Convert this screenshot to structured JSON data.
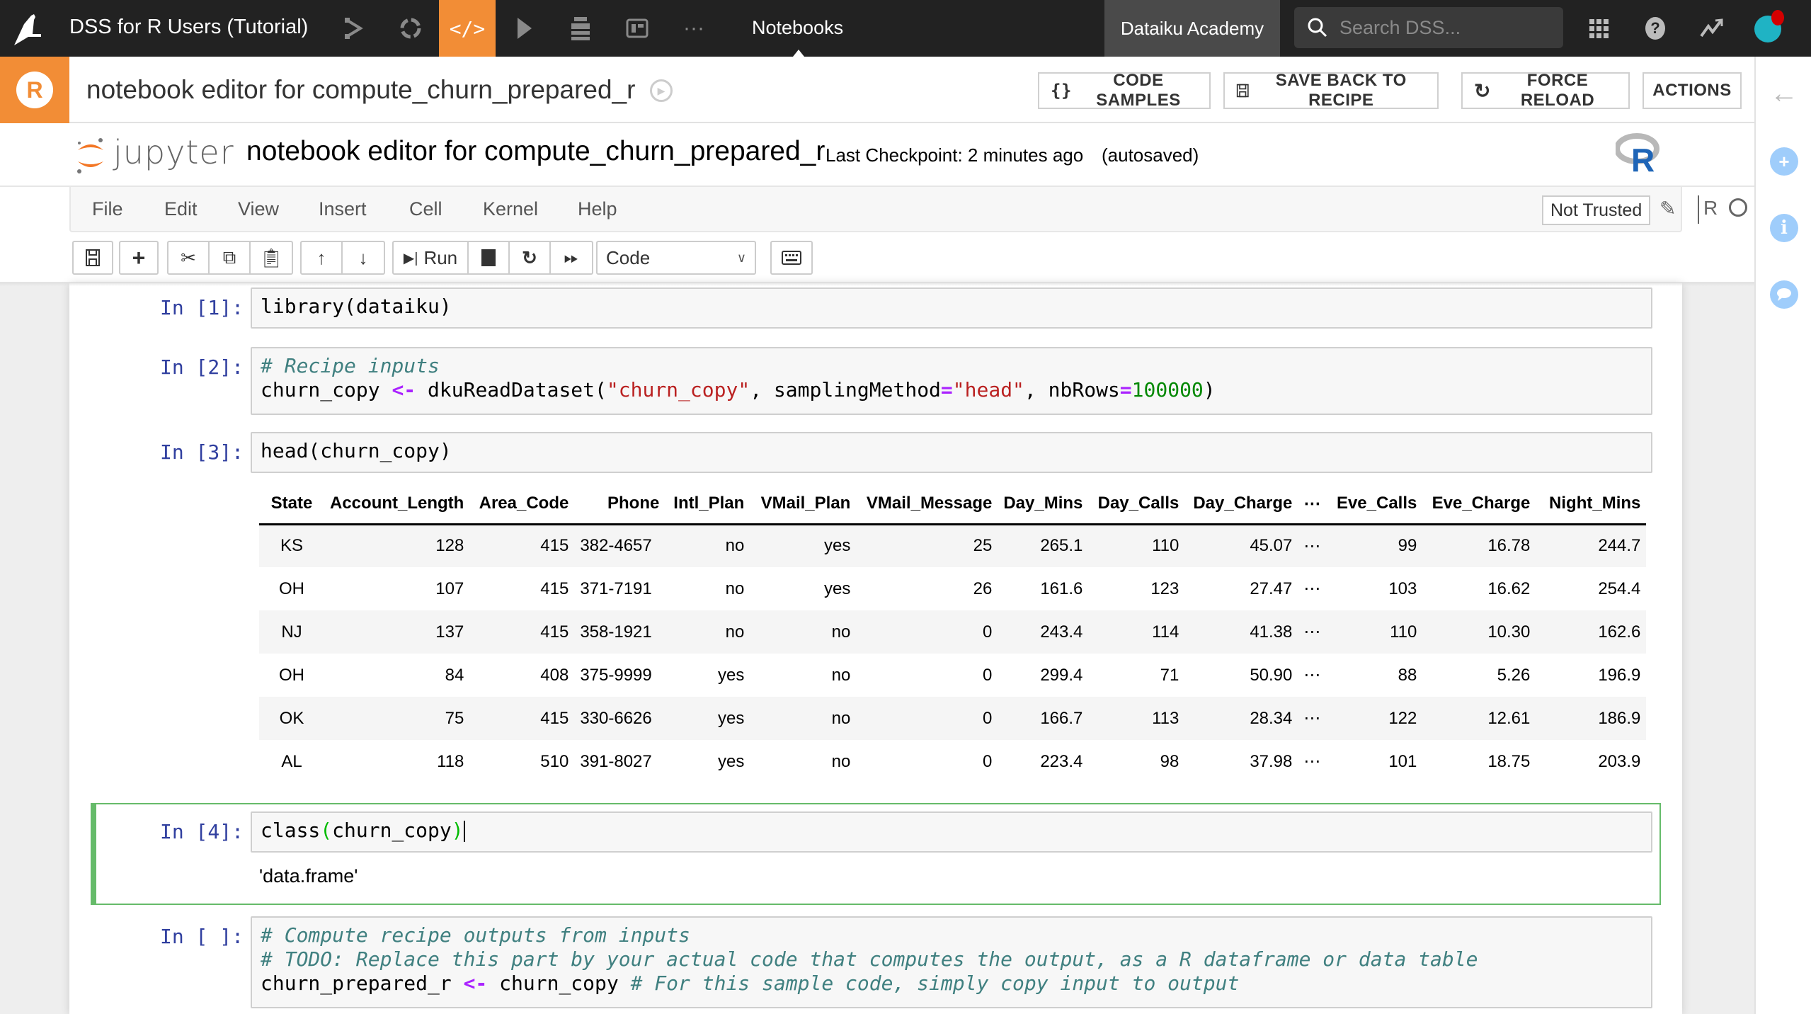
{
  "topnav": {
    "project_name": "DSS for R Users (Tutorial)",
    "icons": [
      "flow-icon",
      "recipes-icon",
      "code-icon",
      "jobs-icon",
      "datasets-icon",
      "dashboard-icon",
      "more-icon"
    ],
    "section": "Notebooks",
    "academy": "Dataiku Academy",
    "search_placeholder": "Search DSS...",
    "accent": "#f28d36"
  },
  "header": {
    "title": "notebook editor for compute_churn_prepared_r",
    "buttons": {
      "code_samples": "CODE SAMPLES",
      "save_back": "SAVE BACK TO RECIPE",
      "force_reload": "FORCE RELOAD",
      "actions": "ACTIONS"
    }
  },
  "jupyter": {
    "brand": "jupyter",
    "notebook_name": "notebook editor for compute_churn_prepared_r",
    "checkpoint": "Last Checkpoint: 2 minutes ago",
    "autosave": "(autosaved)",
    "menu": [
      "File",
      "Edit",
      "View",
      "Insert",
      "Cell",
      "Kernel",
      "Help"
    ],
    "trust": "Not Trusted",
    "kernel": "R",
    "run_label": "Run",
    "cell_type": "Code"
  },
  "cells": [
    {
      "prompt": "In [1]:",
      "lines": [
        "library(dataiku)"
      ]
    },
    {
      "prompt": "In [2]:",
      "comment": "# Recipe inputs",
      "code": {
        "var": "churn_copy",
        "op": "<-",
        "fn": "dkuReadDataset(",
        "str1": "\"churn_copy\"",
        "mid": ", samplingMethod",
        "eq": "=",
        "str2": "\"head\"",
        "mid2": ", nbRows",
        "num": "100000",
        "end": ")"
      }
    },
    {
      "prompt": "In [3]:",
      "lines": [
        "head(churn_copy)"
      ]
    },
    {
      "prompt": "In [4]:",
      "fn": "class",
      "arg": "churn_copy",
      "output": "'data.frame'"
    },
    {
      "prompt": "In [ ]:",
      "comment1": "# Compute recipe outputs from inputs",
      "comment2": "# TODO: Replace this part by your actual code that computes the output, as a R dataframe or data table",
      "var": "churn_prepared_r",
      "op": "<-",
      "src": "churn_copy",
      "comment3": "# For this sample code, simply copy input to output"
    }
  ],
  "table": {
    "columns": [
      "State",
      "Account_Length",
      "Area_Code",
      "Phone",
      "Intl_Plan",
      "VMail_Plan",
      "VMail_Message",
      "Day_Mins",
      "Day_Calls",
      "Day_Charge",
      "⋯",
      "Eve_Calls",
      "Eve_Charge",
      "Night_Mins"
    ],
    "rows": [
      [
        "KS",
        "128",
        "415",
        "382-4657",
        "no",
        "yes",
        "25",
        "265.1",
        "110",
        "45.07",
        "⋯",
        "99",
        "16.78",
        "244.7"
      ],
      [
        "OH",
        "107",
        "415",
        "371-7191",
        "no",
        "yes",
        "26",
        "161.6",
        "123",
        "27.47",
        "⋯",
        "103",
        "16.62",
        "254.4"
      ],
      [
        "NJ",
        "137",
        "415",
        "358-1921",
        "no",
        "no",
        "0",
        "243.4",
        "114",
        "41.38",
        "⋯",
        "110",
        "10.30",
        "162.6"
      ],
      [
        "OH",
        "84",
        "408",
        "375-9999",
        "yes",
        "no",
        "0",
        "299.4",
        "71",
        "50.90",
        "⋯",
        "88",
        "5.26",
        "196.9"
      ],
      [
        "OK",
        "75",
        "415",
        "330-6626",
        "yes",
        "no",
        "0",
        "166.7",
        "113",
        "28.34",
        "⋯",
        "122",
        "12.61",
        "186.9"
      ],
      [
        "AL",
        "118",
        "510",
        "391-8027",
        "yes",
        "no",
        "0",
        "223.4",
        "98",
        "37.98",
        "⋯",
        "101",
        "18.75",
        "203.9"
      ]
    ]
  }
}
